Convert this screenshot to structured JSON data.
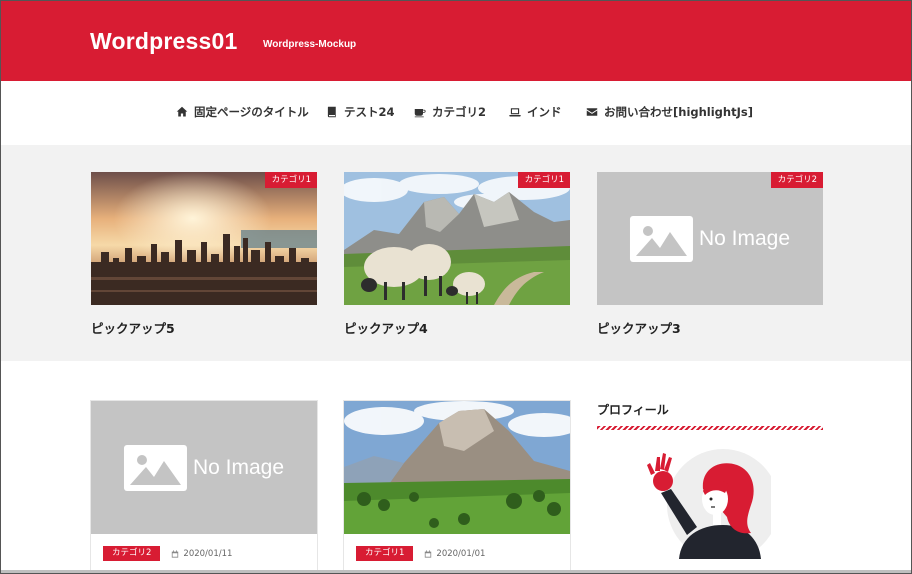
{
  "header": {
    "site_title": "Wordpress01",
    "site_description": "Wordpress-Mockup",
    "background_color": "#d81c33"
  },
  "nav": {
    "items": [
      {
        "label": "固定ページのタイトル",
        "icon": "home-icon"
      },
      {
        "label": "テスト24",
        "icon": "book-icon"
      },
      {
        "label": "カテゴリ2",
        "icon": "coffee-icon"
      },
      {
        "label": "インド",
        "icon": "laptop-icon"
      },
      {
        "label": "お問い合わせ[highlightJs]",
        "icon": "envelope-icon"
      }
    ]
  },
  "pickup": {
    "cards": [
      {
        "title": "ピックアップ5",
        "category": "カテゴリ1",
        "image": "city-sunset-photo"
      },
      {
        "title": "ピックアップ4",
        "category": "カテゴリ1",
        "image": "sheep-mountains-photo"
      },
      {
        "title": "ピックアップ3",
        "category": "カテゴリ2",
        "image": "no-image-placeholder",
        "placeholder_text": "No Image"
      }
    ]
  },
  "posts": [
    {
      "category": "カテゴリ2",
      "date": "2020/01/11",
      "image": "no-image-placeholder",
      "placeholder_text": "No Image"
    },
    {
      "category": "カテゴリ1",
      "date": "2020/01/01",
      "image": "mountain-valley-photo"
    }
  ],
  "sidebar": {
    "profile_title": "プロフィール",
    "avatar": "waving-woman-illustration"
  },
  "colors": {
    "accent": "#d81c33",
    "pickup_background": "#f2f2f2",
    "placeholder_gray": "#c4c4c4"
  }
}
